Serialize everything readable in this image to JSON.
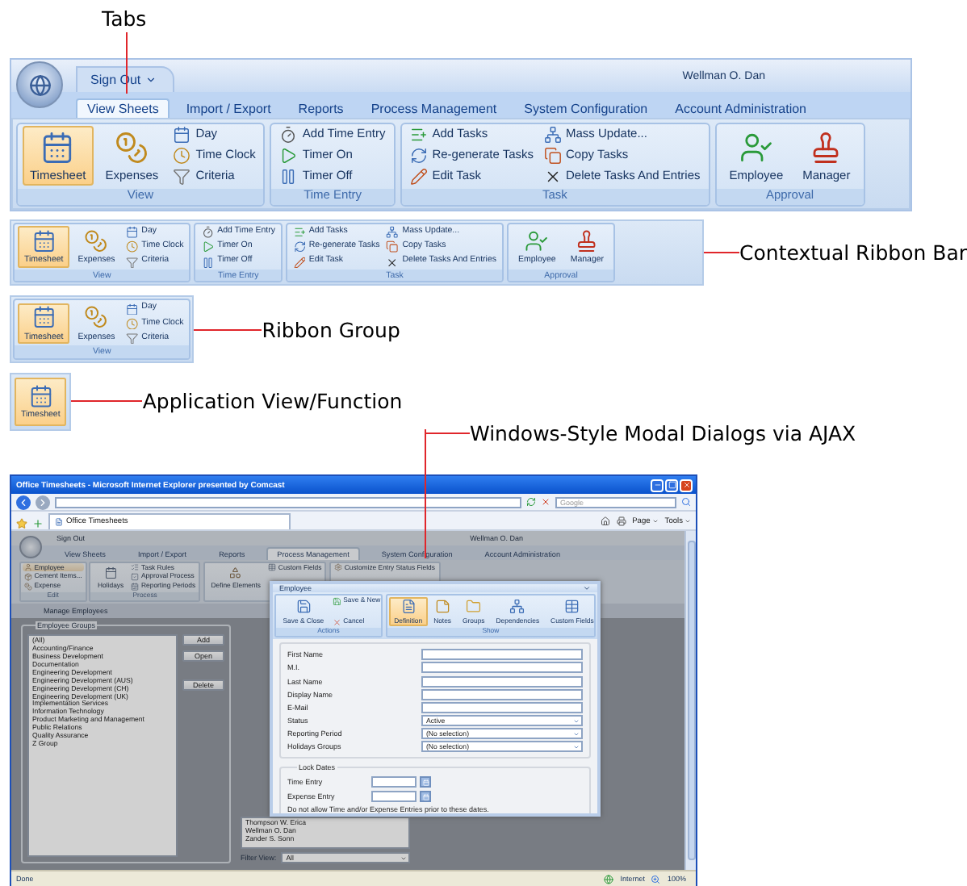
{
  "tabs_callout": "Tabs",
  "main_ribbon": {
    "sign_out": "Sign Out",
    "user": "Wellman O. Dan",
    "tabs": [
      {
        "label": "View Sheets",
        "selected": true
      },
      {
        "label": "Import / Export",
        "selected": false
      },
      {
        "label": "Reports",
        "selected": false
      },
      {
        "label": "Process Management",
        "selected": false
      },
      {
        "label": "System Configuration",
        "selected": false
      },
      {
        "label": "Account Administration",
        "selected": false
      }
    ],
    "groups": [
      {
        "label": "View",
        "items": [
          {
            "label": "Timesheet",
            "kind": "large",
            "selected": true
          },
          {
            "label": "Expenses",
            "kind": "large",
            "selected": false
          },
          {
            "label": "Day",
            "kind": "small"
          },
          {
            "label": "Time Clock",
            "kind": "small"
          },
          {
            "label": "Criteria",
            "kind": "small"
          }
        ]
      },
      {
        "label": "Time Entry",
        "items": [
          {
            "label": "Add Time Entry",
            "kind": "small"
          },
          {
            "label": "Timer On",
            "kind": "small"
          },
          {
            "label": "Timer Off",
            "kind": "small"
          }
        ]
      },
      {
        "label": "Task",
        "items": [
          {
            "label": "Add Tasks",
            "kind": "small"
          },
          {
            "label": "Re-generate Tasks",
            "kind": "small"
          },
          {
            "label": "Edit Task",
            "kind": "small"
          },
          {
            "label": "Mass Update...",
            "kind": "small"
          },
          {
            "label": "Copy Tasks",
            "kind": "small"
          },
          {
            "label": "Delete Tasks And Entries",
            "kind": "small"
          }
        ]
      },
      {
        "label": "Approval",
        "items": [
          {
            "label": "Employee",
            "kind": "large",
            "selected": false
          },
          {
            "label": "Manager",
            "kind": "large",
            "selected": false
          }
        ]
      }
    ]
  },
  "contextual_ribbon": {
    "callout": "Contextual Ribbon Bar",
    "groups": [
      {
        "label": "View",
        "items": [
          {
            "label": "Timesheet",
            "kind": "large",
            "selected": true
          },
          {
            "label": "Expenses",
            "kind": "large",
            "selected": false
          },
          {
            "label": "Day",
            "kind": "small"
          },
          {
            "label": "Time Clock",
            "kind": "small"
          },
          {
            "label": "Criteria",
            "kind": "small"
          }
        ]
      },
      {
        "label": "Time Entry",
        "items": [
          {
            "label": "Add Time Entry",
            "kind": "small"
          },
          {
            "label": "Timer On",
            "kind": "small"
          },
          {
            "label": "Timer Off",
            "kind": "small"
          }
        ]
      },
      {
        "label": "Task",
        "items": [
          {
            "label": "Add Tasks",
            "kind": "small"
          },
          {
            "label": "Re-generate Tasks",
            "kind": "small"
          },
          {
            "label": "Edit Task",
            "kind": "small"
          },
          {
            "label": "Mass Update...",
            "kind": "small"
          },
          {
            "label": "Copy Tasks",
            "kind": "small"
          },
          {
            "label": "Delete Tasks And Entries",
            "kind": "small"
          }
        ]
      },
      {
        "label": "Approval",
        "items": [
          {
            "label": "Employee",
            "kind": "large",
            "selected": false
          },
          {
            "label": "Manager",
            "kind": "large",
            "selected": false
          }
        ]
      }
    ]
  },
  "ribbon_group": {
    "callout": "Ribbon Group",
    "group": {
      "label": "View",
      "items": [
        {
          "label": "Timesheet",
          "kind": "large",
          "selected": true
        },
        {
          "label": "Expenses",
          "kind": "large",
          "selected": false
        },
        {
          "label": "Day",
          "kind": "small"
        },
        {
          "label": "Time Clock",
          "kind": "small"
        },
        {
          "label": "Criteria",
          "kind": "small"
        }
      ]
    }
  },
  "app_function": {
    "callout": "Application View/Function",
    "label": "Timesheet",
    "selected": true
  },
  "dialogs_callout": "Windows-Style Modal Dialogs via AJAX",
  "browser": {
    "title": "Office Timesheets - Microsoft Internet Explorer presented by Comcast",
    "search_placeholder": "Google",
    "tab": "Office Timesheets",
    "menus": [
      "Page",
      "Tools"
    ],
    "app": {
      "sign_out": "Sign Out",
      "user": "Wellman O. Dan",
      "tabs": [
        {
          "label": "View Sheets",
          "selected": false
        },
        {
          "label": "Import / Export",
          "selected": false
        },
        {
          "label": "Reports",
          "selected": false
        },
        {
          "label": "Process Management",
          "selected": true
        },
        {
          "label": "System Configuration",
          "selected": false
        },
        {
          "label": "Account Administration",
          "selected": false
        }
      ],
      "groups": [
        {
          "label": "Edit",
          "items": [
            {
              "label": "Employee",
              "kind": "small",
              "selected": true
            },
            {
              "label": "Cement Items...",
              "kind": "small",
              "selected": false
            },
            {
              "label": "Expense",
              "kind": "small",
              "selected": false
            }
          ]
        },
        {
          "label": "Process",
          "items": [
            {
              "label": "Holidays",
              "kind": "large",
              "selected": false
            },
            {
              "label": "Task Rules",
              "kind": "small",
              "selected": false
            },
            {
              "label": "Approval Process",
              "kind": "small",
              "selected": false
            },
            {
              "label": "Reporting Periods",
              "kind": "small",
              "selected": false
            }
          ]
        },
        {
          "items": [
            {
              "label": "Define Elements",
              "kind": "large",
              "selected": false
            },
            {
              "label": "Custom Fields",
              "kind": "small",
              "selected": false
            }
          ]
        },
        {
          "items": [
            {
              "label": "Customize Entry Status Fields",
              "kind": "small",
              "selected": false
            }
          ]
        }
      ],
      "page_title": "Manage Employees",
      "groups_legend": "Employee Groups",
      "employee_groups": [
        "(All)",
        "Accounting/Finance",
        "Business Development",
        "Documentation",
        "Engineering Development",
        "Engineering Development (AUS)",
        "Engineering Development (CH)",
        "Engineering Development (UK)",
        "Implementation Services",
        "Information Technology",
        "Product Marketing and Management",
        "Public Relations",
        "Quality Assurance",
        "Z Group"
      ],
      "buttons": [
        "Add",
        "Open",
        "Delete"
      ],
      "employees": [
        "Thompson W. Erica",
        "Wellman O. Dan",
        "Zander S. Sonn"
      ],
      "filter_label": "Filter View:",
      "filter_value": "All"
    },
    "dialog": {
      "title": "Employee",
      "groups": [
        {
          "label": "Actions",
          "items": [
            {
              "label": "Save & Close",
              "kind": "large",
              "selected": false
            },
            {
              "label": "Save & New",
              "kind": "small"
            },
            {
              "label": "Cancel",
              "kind": "small"
            }
          ]
        },
        {
          "label": "Show",
          "items": [
            {
              "label": "Definition",
              "kind": "large",
              "selected": true
            },
            {
              "label": "Notes",
              "kind": "large",
              "selected": false
            },
            {
              "label": "Groups",
              "kind": "large",
              "selected": false
            },
            {
              "label": "Dependencies",
              "kind": "large",
              "selected": false
            },
            {
              "label": "Custom Fields",
              "kind": "large",
              "selected": false
            }
          ]
        }
      ],
      "fields": [
        {
          "label": "First Name",
          "kind": "text"
        },
        {
          "label": "M.I.",
          "kind": "text"
        },
        {
          "label": "Last Name",
          "kind": "text"
        },
        {
          "label": "Display Name",
          "kind": "text"
        },
        {
          "label": "E-Mail",
          "kind": "text"
        },
        {
          "label": "Status",
          "kind": "select",
          "value": "Active"
        },
        {
          "label": "Reporting Period",
          "kind": "select",
          "value": "(No selection)"
        },
        {
          "label": "Holidays Groups",
          "kind": "select",
          "value": "(No selection)"
        }
      ],
      "lock_legend": "Lock Dates",
      "lock_fields": [
        "Time Entry",
        "Expense Entry"
      ],
      "note": "Do not allow Time and/or Expense Entries prior to these dates."
    },
    "status": "Done",
    "zone": "Internet",
    "zoom": "100%"
  }
}
